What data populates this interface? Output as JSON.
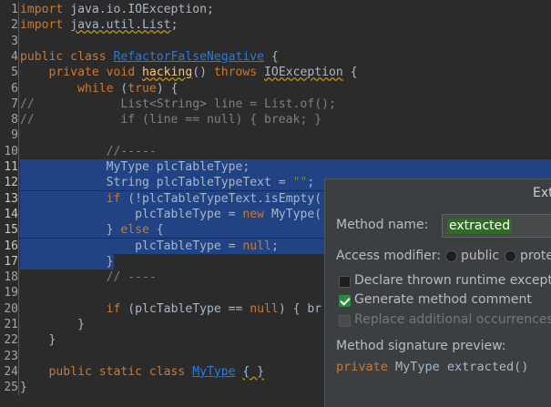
{
  "editor": {
    "lines": [
      {
        "num": "1",
        "parts": [
          {
            "t": "import",
            "c": "kw"
          },
          {
            "t": " java.io.IOException;",
            "c": ""
          }
        ]
      },
      {
        "num": "2",
        "parts": [
          {
            "t": "import",
            "c": "kw"
          },
          {
            "t": " ",
            "c": ""
          },
          {
            "t": "java.util.List",
            "c": "warn"
          },
          {
            "t": ";",
            "c": ""
          }
        ]
      },
      {
        "num": "3",
        "parts": []
      },
      {
        "num": "4",
        "parts": [
          {
            "t": "public class ",
            "c": "kw"
          },
          {
            "t": "RefactorFalseNegative",
            "c": "lnk"
          },
          {
            "t": " {",
            "c": ""
          }
        ]
      },
      {
        "num": "5",
        "parts": [
          {
            "t": "    private void ",
            "c": "kw"
          },
          {
            "t": "hacking",
            "c": "nm"
          },
          {
            "t": "() ",
            "c": ""
          },
          {
            "t": "throws ",
            "c": "kw"
          },
          {
            "t": "IOException",
            "c": "warn"
          },
          {
            "t": " {",
            "c": ""
          }
        ]
      },
      {
        "num": "6",
        "parts": [
          {
            "t": "        while ",
            "c": "kw"
          },
          {
            "t": "(",
            "c": ""
          },
          {
            "t": "true",
            "c": "kw"
          },
          {
            "t": ") {",
            "c": ""
          }
        ]
      },
      {
        "num": "7",
        "parts": [
          {
            "t": "//            List<String> line = List.of();",
            "c": "cm"
          }
        ]
      },
      {
        "num": "8",
        "parts": [
          {
            "t": "//            if (line == null) { break; }",
            "c": "cm"
          }
        ]
      },
      {
        "num": "9",
        "parts": []
      },
      {
        "num": "10",
        "parts": [
          {
            "t": "            //-----",
            "c": "cm"
          }
        ]
      },
      {
        "num": "11",
        "sel": true,
        "parts": [
          {
            "t": "            MyType plcTableType;",
            "c": ""
          }
        ]
      },
      {
        "num": "12",
        "sel": true,
        "parts": [
          {
            "t": "            String plcTableTypeText = ",
            "c": ""
          },
          {
            "t": "\"\"",
            "c": "str"
          },
          {
            "t": ";",
            "c": ""
          }
        ]
      },
      {
        "num": "13",
        "sel": true,
        "parts": [
          {
            "t": "            ",
            "c": ""
          },
          {
            "t": "if ",
            "c": "kw"
          },
          {
            "t": "(!plcTableTypeText.isEmpty(",
            "c": ""
          }
        ]
      },
      {
        "num": "14",
        "sel": true,
        "parts": [
          {
            "t": "                plcTableType = ",
            "c": ""
          },
          {
            "t": "new ",
            "c": "kw"
          },
          {
            "t": "MyType(",
            "c": ""
          }
        ]
      },
      {
        "num": "15",
        "sel": true,
        "parts": [
          {
            "t": "            } ",
            "c": ""
          },
          {
            "t": "else ",
            "c": "kw"
          },
          {
            "t": "{",
            "c": ""
          }
        ]
      },
      {
        "num": "16",
        "sel": true,
        "parts": [
          {
            "t": "                plcTableType = ",
            "c": ""
          },
          {
            "t": "null",
            "c": "kw"
          },
          {
            "t": ";",
            "c": ""
          }
        ]
      },
      {
        "num": "17",
        "selpart": true,
        "parts": [
          {
            "t": "            }",
            "c": ""
          }
        ]
      },
      {
        "num": "18",
        "parts": [
          {
            "t": "            // ----",
            "c": "cm"
          }
        ]
      },
      {
        "num": "19",
        "parts": []
      },
      {
        "num": "20",
        "parts": [
          {
            "t": "            ",
            "c": ""
          },
          {
            "t": "if ",
            "c": "kw"
          },
          {
            "t": "(plcTableType == ",
            "c": ""
          },
          {
            "t": "null",
            "c": "kw"
          },
          {
            "t": ") { br",
            "c": ""
          }
        ]
      },
      {
        "num": "21",
        "parts": [
          {
            "t": "        }",
            "c": ""
          }
        ]
      },
      {
        "num": "22",
        "parts": [
          {
            "t": "    }",
            "c": ""
          }
        ]
      },
      {
        "num": "23",
        "parts": []
      },
      {
        "num": "24",
        "parts": [
          {
            "t": "    public static class ",
            "c": "kw"
          },
          {
            "t": "MyType",
            "c": "lnk"
          },
          {
            "t": " ",
            "c": ""
          },
          {
            "t": "{ }",
            "c": "warn"
          }
        ]
      },
      {
        "num": "25",
        "parts": [
          {
            "t": "}",
            "c": ""
          }
        ]
      }
    ]
  },
  "dialog": {
    "title": "Ext",
    "method_name_label": "Method name:",
    "method_name_value": "extracted",
    "access_modifier_label": "Access modifier:",
    "access_public": "public",
    "access_protected": "prote",
    "declare_thrown": "Declare thrown runtime exceptio",
    "generate_comment": "Generate method comment",
    "replace_occurrences": "Replace additional occurrences o",
    "signature_label": "Method signature preview:",
    "signature_kw": "private",
    "signature_rest": " MyType extracted()"
  },
  "colors": {
    "background": "#2b2b2b",
    "keyword": "#cc7832",
    "string": "#6a8759",
    "comment": "#808080",
    "selection": "#214283",
    "dialog_bg": "#3c3f41"
  }
}
